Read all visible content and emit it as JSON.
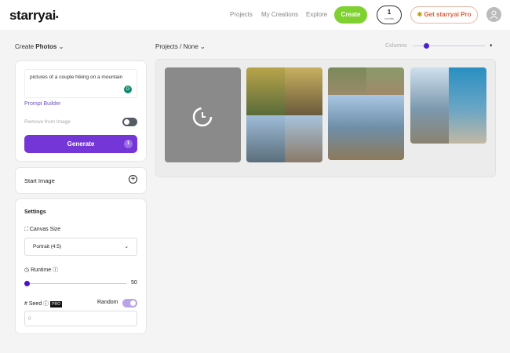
{
  "header": {
    "logo": "starryai",
    "nav": [
      "Projects",
      "My Creations",
      "Explore"
    ],
    "create": "Create",
    "credits": {
      "count": "1",
      "label": "credits"
    },
    "pro": "Get starryai Pro"
  },
  "toolbar": {
    "create_prefix": "Create",
    "create_mode": "Photos",
    "projects": "Projects / None",
    "columns": "Columns",
    "columns_value": 0.1
  },
  "prompt": {
    "text": "pictures of a couple hiking on a mountain",
    "builder": "Prompt Builder",
    "remove": "Remove from Image",
    "generate": "Generate",
    "generate_cost": "1"
  },
  "start_image": {
    "label": "Start Image"
  },
  "settings": {
    "title": "Settings",
    "canvas_label": "Canvas Size",
    "canvas_value": "Portrait (4:5)",
    "runtime_label": "Runtime",
    "runtime_value": "50",
    "seed_label": "Seed",
    "pro_badge": "PRO",
    "random_label": "Random",
    "seed_value": "0"
  }
}
